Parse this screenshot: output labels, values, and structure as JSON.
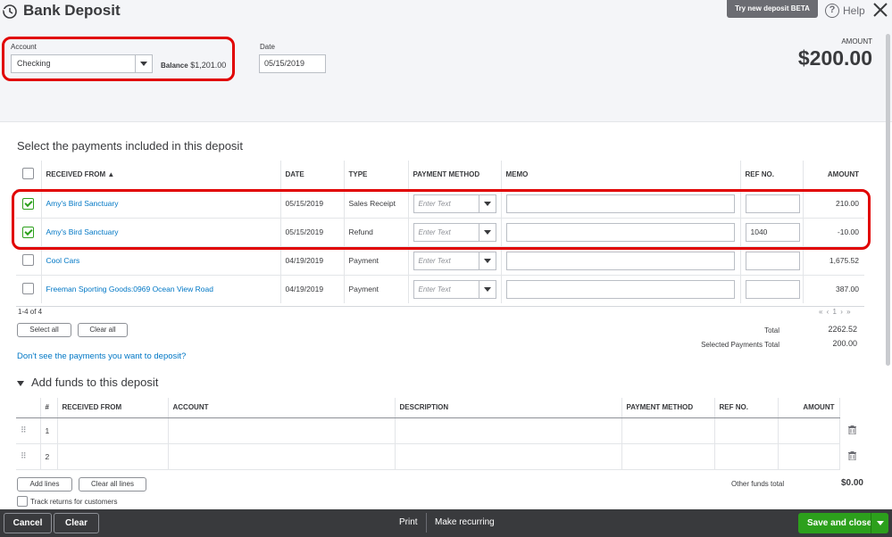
{
  "header": {
    "title": "Bank Deposit",
    "try_new": "Try new deposit BETA",
    "help": "Help",
    "account_label": "Account",
    "account_value": "Checking",
    "balance_label": "Balance",
    "balance_value": "$1,201.00",
    "date_label": "Date",
    "date_value": "05/15/2019",
    "amount_label": "AMOUNT",
    "amount_value": "$200.00"
  },
  "payments": {
    "title": "Select the payments included in this deposit",
    "columns": [
      "RECEIVED FROM ▲",
      "DATE",
      "TYPE",
      "PAYMENT METHOD",
      "MEMO",
      "REF NO.",
      "AMOUNT"
    ],
    "rows": [
      {
        "checked": true,
        "received_from": "Amy's Bird Sanctuary",
        "date": "05/15/2019",
        "type": "Sales Receipt",
        "method_placeholder": "Enter Text",
        "ref": "",
        "amount": "210.00"
      },
      {
        "checked": true,
        "received_from": "Amy's Bird Sanctuary",
        "date": "05/15/2019",
        "type": "Refund",
        "method_placeholder": "Enter Text",
        "ref": "1040",
        "amount": "-10.00"
      },
      {
        "checked": false,
        "received_from": "Cool Cars",
        "date": "04/19/2019",
        "type": "Payment",
        "method_placeholder": "Enter Text",
        "ref": "",
        "amount": "1,675.52"
      },
      {
        "checked": false,
        "received_from": "Freeman Sporting Goods:0969 Ocean View Road",
        "date": "04/19/2019",
        "type": "Payment",
        "method_placeholder": "Enter Text",
        "ref": "",
        "amount": "387.00"
      }
    ],
    "pager_text": "1-4 of 4",
    "pager_nav": "« ‹ 1 › »",
    "select_all": "Select all",
    "clear_all": "Clear all",
    "total_label": "Total",
    "total_value": "2262.52",
    "selected_label": "Selected Payments Total",
    "selected_value": "200.00",
    "dont_see": "Don't see the payments you want to deposit?"
  },
  "funds": {
    "title": "Add funds to this deposit",
    "columns": [
      "#",
      "RECEIVED FROM",
      "ACCOUNT",
      "DESCRIPTION",
      "PAYMENT METHOD",
      "REF NO.",
      "AMOUNT"
    ],
    "rows": [
      {
        "num": "1"
      },
      {
        "num": "2"
      }
    ],
    "add_lines": "Add lines",
    "clear_all_lines": "Clear all lines",
    "other_total_label": "Other funds total",
    "other_total_value": "$0.00",
    "track_returns": "Track returns for customers"
  },
  "footer": {
    "cancel": "Cancel",
    "clear": "Clear",
    "print": "Print",
    "make_recurring": "Make recurring",
    "save": "Save and close"
  }
}
